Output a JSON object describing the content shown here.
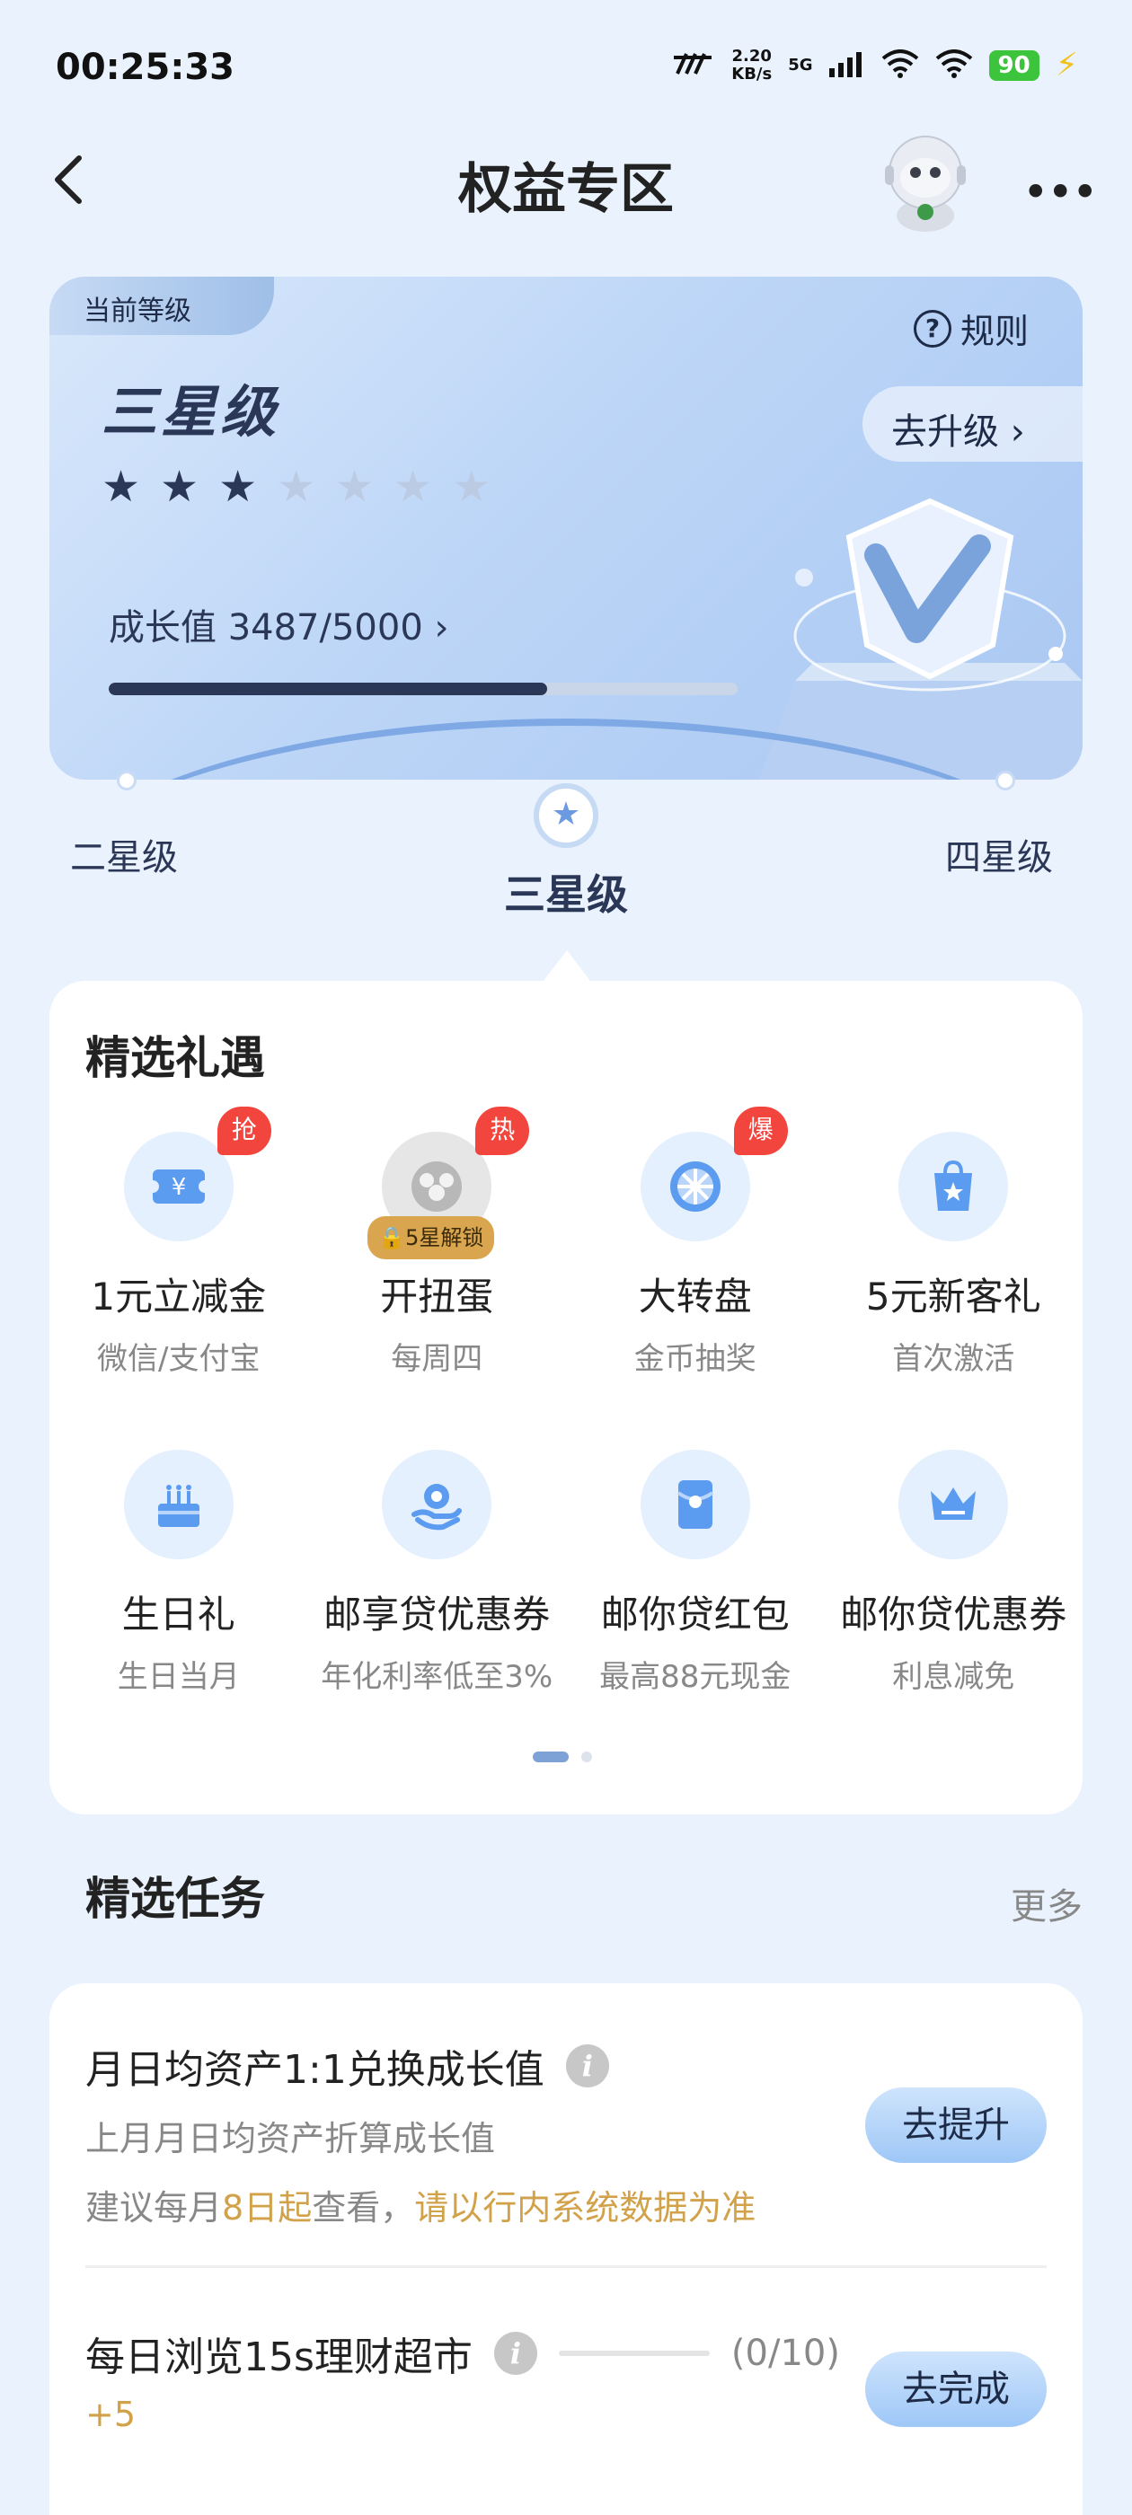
{
  "status_bar": {
    "time": "00:25:33",
    "speed_value": "2.20",
    "speed_unit": "KB/s",
    "network": "5G",
    "battery": "90",
    "icons": [
      "network-logo-icon",
      "signal-icon",
      "wifi-icon",
      "wifi-icon",
      "battery-icon",
      "charging-icon"
    ]
  },
  "header": {
    "title": "权益专区",
    "back_icon": "back-arrow-icon",
    "avatar": "robot-mascot",
    "more_icon": "more-dots-icon",
    "more_glyph": "•••"
  },
  "level_card": {
    "tag": "当前等级",
    "rules_icon_glyph": "?",
    "rules_label": "规则",
    "upgrade_label": "去升级 ›",
    "level_name": "三星级",
    "stars_total": 7,
    "stars_filled": 3,
    "star_glyph": "★",
    "growth_label": "成长值 3487/5000 ›",
    "growth_current": 3487,
    "growth_target": 5000
  },
  "level_selector": {
    "prev": "二星级",
    "current": "三星级",
    "next": "四星级",
    "dot_glyph": "★"
  },
  "gifts": {
    "title": "精选礼遇",
    "items": [
      {
        "name": "1元立减金",
        "desc": "微信/支付宝",
        "badge": "抢",
        "icon": "coupon-icon"
      },
      {
        "name": "开扭蛋",
        "desc": "每周四",
        "badge": "热",
        "lock": "🔒5星解锁",
        "icon": "gashapon-icon"
      },
      {
        "name": "大转盘",
        "desc": "金币抽奖",
        "badge": "爆",
        "icon": "wheel-icon"
      },
      {
        "name": "5元新客礼",
        "desc": "首次激活",
        "icon": "gift-bag-icon"
      },
      {
        "name": "生日礼",
        "desc": "生日当月",
        "icon": "cake-icon"
      },
      {
        "name": "邮享贷优惠券",
        "desc": "年化利率低至3%",
        "icon": "loan-icon"
      },
      {
        "name": "邮你贷红包",
        "desc": "最高88元现金",
        "icon": "red-packet-icon"
      },
      {
        "name": "邮你贷优惠券",
        "desc": "利息减免",
        "icon": "crown-icon"
      }
    ],
    "page_count": 2,
    "active_page": 1
  },
  "tasks": {
    "title": "精选任务",
    "more": "更多",
    "info_glyph": "i",
    "items": [
      {
        "title": "月日均资产1:1兑换成长值",
        "subtitle": "上月月日均资产折算成长值",
        "hint_prefix": "建议每月",
        "hint_date": "8日起",
        "hint_middle": "查看，",
        "hint_note": "请以行内系统数据为准",
        "button": "去提升"
      },
      {
        "title": "每日浏览15s理财超市",
        "count": "(0/10)",
        "progress": 0,
        "reward": "+5",
        "button": "去完成"
      }
    ]
  },
  "colors": {
    "accent_dark": "#2b3756",
    "accent_gold": "#d1a24a",
    "badge_red": "#f2453d",
    "button_blue": "#9ec7f7"
  }
}
